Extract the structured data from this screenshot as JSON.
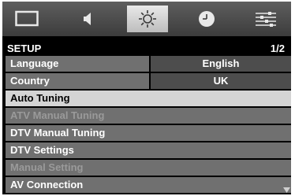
{
  "tabs": [
    {
      "icon": "picture-icon"
    },
    {
      "icon": "speaker-icon"
    },
    {
      "icon": "gear-icon",
      "active": true
    },
    {
      "icon": "clock-icon"
    },
    {
      "icon": "equalizer-icon"
    }
  ],
  "header": {
    "title": "SETUP",
    "page": "1/2"
  },
  "menu": {
    "language": {
      "label": "Language",
      "value": "English"
    },
    "country": {
      "label": "Country",
      "value": "UK"
    },
    "auto_tuning": "Auto Tuning",
    "atv_manual_tuning": "ATV Manual Tuning",
    "dtv_manual_tuning": "DTV Manual Tuning",
    "dtv_settings": "DTV Settings",
    "manual_setting": "Manual Setting",
    "av_connection": "AV Connection"
  },
  "colors": {
    "row_bg": "#707070",
    "value_bg": "#4d4d4d",
    "selected_bg": "#d4d4d4",
    "disabled_text": "#9a9a9a"
  }
}
